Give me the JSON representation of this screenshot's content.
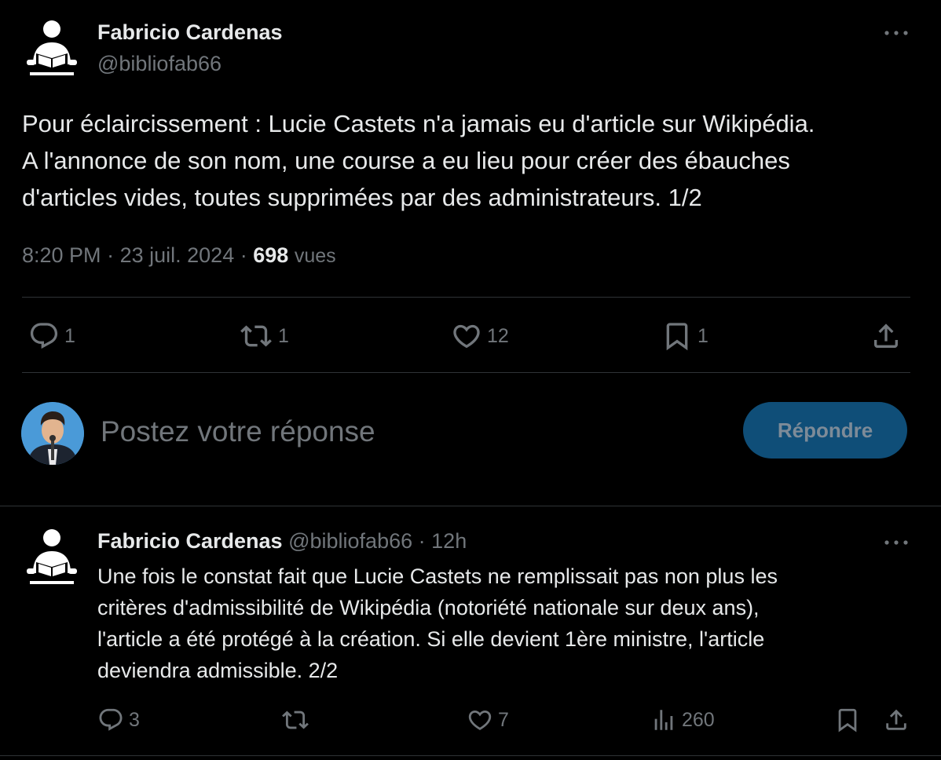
{
  "main_tweet": {
    "author_name": "Fabricio Cardenas",
    "author_handle": "@bibliofab66",
    "text": "Pour éclaircissement : Lucie Castets n'a jamais eu d'article sur Wikipédia.\nA l'annonce de son nom, une course a eu lieu pour créer des ébauches\nd'articles vides, toutes supprimées par des administrateurs. 1/2",
    "time": "8:20 PM",
    "separator": "·",
    "date": "23 juil. 2024",
    "views_count": "698",
    "views_label": "vues",
    "actions": {
      "replies": "1",
      "reposts": "1",
      "likes": "12",
      "bookmarks": "1"
    }
  },
  "reply_composer": {
    "placeholder": "Postez votre réponse",
    "button_label": "Répondre"
  },
  "second_tweet": {
    "author_name": "Fabricio Cardenas",
    "author_handle": "@bibliofab66",
    "separator": "·",
    "time_ago": "12h",
    "text": "Une fois le constat fait que Lucie Castets ne remplissait pas non plus les\ncritères d'admissibilité de Wikipédia (notoriété nationale sur deux ans),\nl'article a été protégé à la création. Si elle devient 1ère ministre, l'article\ndeviendra admissible. 2/2",
    "actions": {
      "replies": "3",
      "reposts": "",
      "likes": "7",
      "views": "260"
    }
  },
  "colors": {
    "background": "#000000",
    "text": "#e7e9ea",
    "muted": "#71767b",
    "divider": "#2f3336",
    "reply_button_bg": "#0f4e78"
  },
  "icons": [
    "reader-avatar-icon",
    "more-icon",
    "reply-icon",
    "repost-icon",
    "like-icon",
    "bookmark-icon",
    "share-icon",
    "views-icon"
  ]
}
